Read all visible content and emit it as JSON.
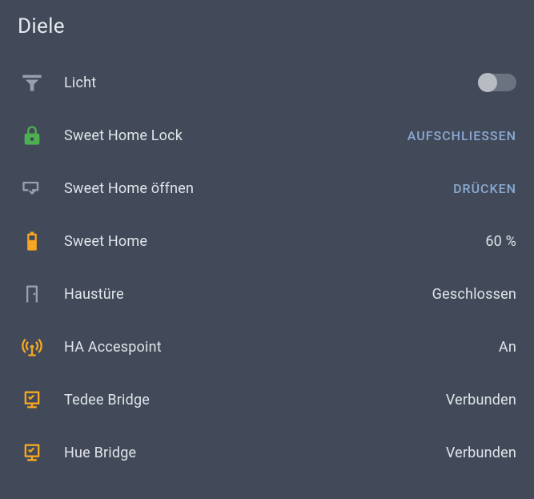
{
  "title": "Diele",
  "rows": {
    "light": {
      "label": "Licht",
      "on": false
    },
    "lock": {
      "label": "Sweet Home Lock",
      "action": "AUFSCHLIESSEN"
    },
    "open": {
      "label": "Sweet Home öffnen",
      "action": "DRÜCKEN"
    },
    "battery": {
      "label": "Sweet Home",
      "value": "60 %"
    },
    "door": {
      "label": "Haustüre",
      "value": "Geschlossen"
    },
    "ap": {
      "label": "HA Accespoint",
      "value": "An"
    },
    "tedee": {
      "label": "Tedee Bridge",
      "value": "Verbunden"
    },
    "hue": {
      "label": "Hue Bridge",
      "value": "Verbunden"
    }
  }
}
